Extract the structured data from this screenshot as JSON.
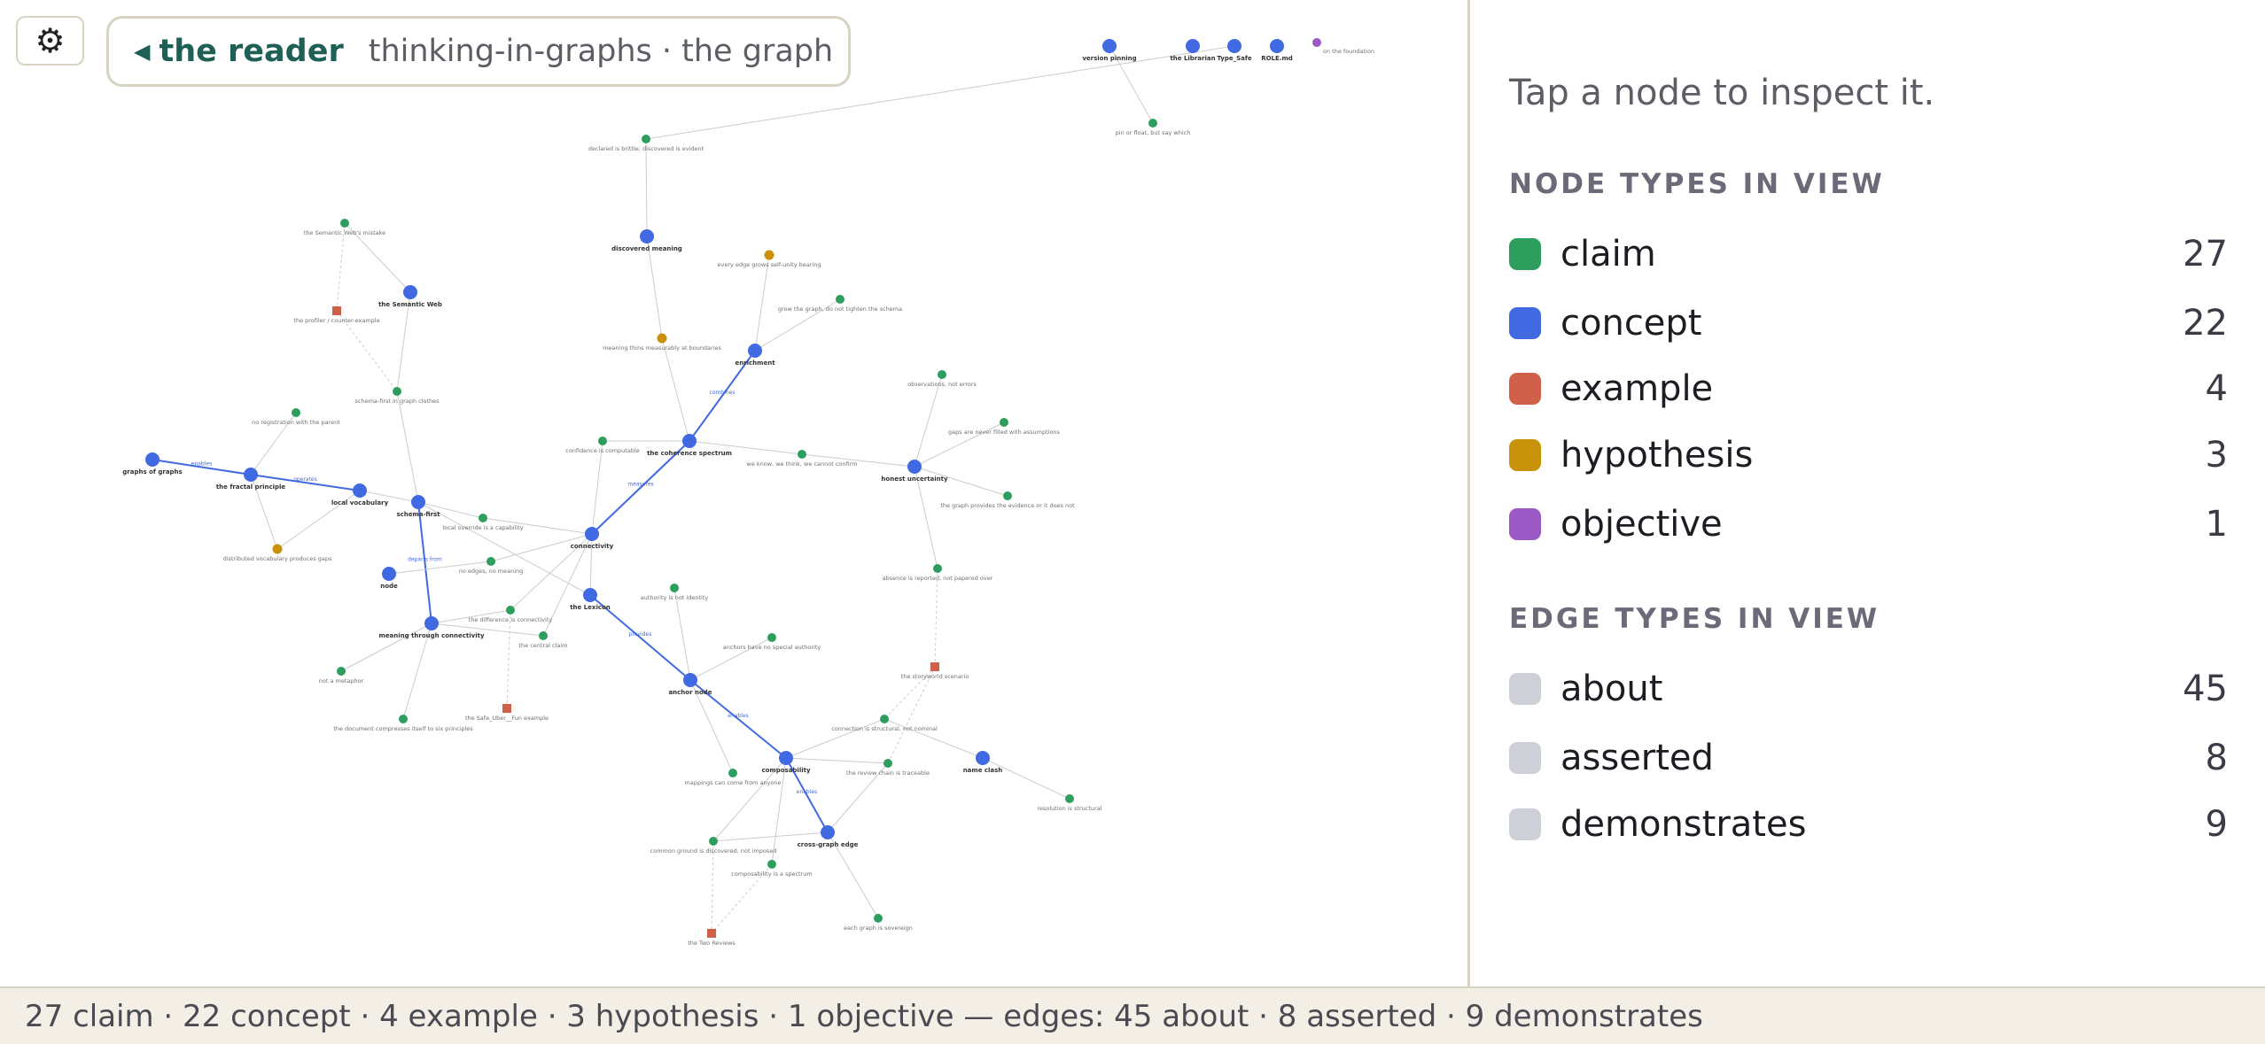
{
  "toolbar": {
    "settings_icon": "gear-icon",
    "settings_glyph": "⚙"
  },
  "breadcrumb": {
    "back_icon": "caret-left-icon",
    "back_label": "the reader",
    "path": "thinking-in-graphs · the graph"
  },
  "inspector": {
    "hint": "Tap a node to inspect it.",
    "node_types_title": "NODE TYPES IN VIEW",
    "node_types": [
      {
        "key": "claim",
        "label": "claim",
        "count": "27",
        "color": "#2e9e5f"
      },
      {
        "key": "concept",
        "label": "concept",
        "count": "22",
        "color": "#4169e1"
      },
      {
        "key": "example",
        "label": "example",
        "count": "4",
        "color": "#d0604a"
      },
      {
        "key": "hypothesis",
        "label": "hypothesis",
        "count": "3",
        "color": "#c8930a"
      },
      {
        "key": "objective",
        "label": "objective",
        "count": "1",
        "color": "#9b59c6"
      }
    ],
    "edge_types_title": "EDGE TYPES IN VIEW",
    "edge_types": [
      {
        "key": "about",
        "label": "about",
        "count": "45",
        "color": "#cdd0d6"
      },
      {
        "key": "asserted",
        "label": "asserted",
        "count": "8",
        "color": "#cdd0d6"
      },
      {
        "key": "demonstrates",
        "label": "demonstrates",
        "count": "9",
        "color": "#cdd0d6"
      }
    ]
  },
  "status": "27 claim · 22 concept · 4 example · 3 hypothesis · 1 objective — edges: 45 about · 8 asserted · 9 demonstrates",
  "graph": {
    "edge_color": "#cccccc",
    "highlight_edge_color": "#4169e1",
    "nodes": [
      {
        "id": "version_pinning",
        "label": "version pinning",
        "type": "concept"
      },
      {
        "id": "the_librarian",
        "label": "the Librarian",
        "type": "concept"
      },
      {
        "id": "type_safe",
        "label": "Type_Safe",
        "type": "concept"
      },
      {
        "id": "role_md",
        "label": "ROLE.md",
        "type": "concept"
      },
      {
        "id": "the_foundation",
        "label": "on the foundation",
        "type": "objective"
      },
      {
        "id": "pin_or_float",
        "label": "pin or float, but say which",
        "type": "claim"
      },
      {
        "id": "declared_is_brittle",
        "label": "declared is brittle; discovered is evident",
        "type": "claim"
      },
      {
        "id": "discovered_meaning",
        "label": "discovered meaning",
        "type": "concept"
      },
      {
        "id": "every_edge_grows",
        "label": "every edge grows self-unity bearing",
        "type": "hypothesis"
      },
      {
        "id": "grow_the_graph",
        "label": "grow the graph, do not tighten the schema",
        "type": "claim"
      },
      {
        "id": "meaning_thins",
        "label": "meaning thins measurably at boundaries",
        "type": "hypothesis"
      },
      {
        "id": "enrichment",
        "label": "enrichment",
        "type": "concept"
      },
      {
        "id": "sw_mistake",
        "label": "the Semantic Web's mistake",
        "type": "claim"
      },
      {
        "id": "semantic_web",
        "label": "the Semantic Web",
        "type": "concept"
      },
      {
        "id": "the_profiler",
        "label": "the profiler / counter-example",
        "type": "example"
      },
      {
        "id": "schema_first_gr",
        "label": "schema-first in graph clothes",
        "type": "claim"
      },
      {
        "id": "no_registration",
        "label": "no registration with the parent",
        "type": "claim"
      },
      {
        "id": "observations",
        "label": "observations, not errors",
        "type": "claim"
      },
      {
        "id": "gaps_are_never",
        "label": "gaps are never filled with assumptions",
        "type": "claim"
      },
      {
        "id": "confidence_comp",
        "label": "confidence is computable",
        "type": "claim"
      },
      {
        "id": "coherence_spectrum",
        "label": "the coherence spectrum",
        "type": "concept"
      },
      {
        "id": "we_know_we_think",
        "label": "we know, we think, we cannot confirm",
        "type": "claim"
      },
      {
        "id": "honest_uncertainty",
        "label": "honest uncertainty",
        "type": "concept"
      },
      {
        "id": "graph_provides",
        "label": "the graph provides the evidence or it does not",
        "type": "claim"
      },
      {
        "id": "graphs_of_graphs",
        "label": "graphs of graphs",
        "type": "concept"
      },
      {
        "id": "fractal_principle",
        "label": "the fractal principle",
        "type": "concept"
      },
      {
        "id": "local_vocabulary",
        "label": "local vocabulary",
        "type": "concept"
      },
      {
        "id": "schema_first",
        "label": "schema-first",
        "type": "concept"
      },
      {
        "id": "local_override",
        "label": "local override is a capability",
        "type": "claim"
      },
      {
        "id": "connectivity",
        "label": "connectivity",
        "type": "concept"
      },
      {
        "id": "distributed_vocab",
        "label": "distributed vocabulary produces gaps",
        "type": "hypothesis"
      },
      {
        "id": "node",
        "label": "node",
        "type": "concept"
      },
      {
        "id": "no_edges",
        "label": "no edges, no meaning",
        "type": "claim"
      },
      {
        "id": "absence_is_reported",
        "label": "absence is reported, not papered over",
        "type": "claim"
      },
      {
        "id": "authority_is_not",
        "label": "authority is not identity",
        "type": "claim"
      },
      {
        "id": "the_lexicon",
        "label": "the Lexicon",
        "type": "concept"
      },
      {
        "id": "the_difference",
        "label": "the difference is connectivity",
        "type": "claim"
      },
      {
        "id": "meaning_through",
        "label": "meaning through connectivity",
        "type": "concept"
      },
      {
        "id": "the_central_claim",
        "label": "the central claim",
        "type": "claim"
      },
      {
        "id": "anchors_have_no",
        "label": "anchors have no special authority",
        "type": "claim"
      },
      {
        "id": "not_a_metaphor",
        "label": "not a metaphor",
        "type": "claim"
      },
      {
        "id": "the_storyworld",
        "label": "the storyworld scenario",
        "type": "example"
      },
      {
        "id": "the_safe_uber",
        "label": "the Safe_Uber__Fun example",
        "type": "example"
      },
      {
        "id": "anchor_node",
        "label": "anchor node",
        "type": "concept"
      },
      {
        "id": "doc_compresses",
        "label": "the document compresses itself to six principles",
        "type": "claim"
      },
      {
        "id": "connection_is_structural",
        "label": "connection is structural, not nominal",
        "type": "claim"
      },
      {
        "id": "name_clash",
        "label": "name clash",
        "type": "concept"
      },
      {
        "id": "composability",
        "label": "composability",
        "type": "concept"
      },
      {
        "id": "review_chain",
        "label": "the review chain is traceable",
        "type": "claim"
      },
      {
        "id": "mappings_can_come",
        "label": "mappings can come from anyone",
        "type": "claim"
      },
      {
        "id": "resolution_structural",
        "label": "resolution is structural",
        "type": "claim"
      },
      {
        "id": "cross_graph_edge",
        "label": "cross-graph edge",
        "type": "concept"
      },
      {
        "id": "common_ground",
        "label": "common ground is discovered, not imposed",
        "type": "claim"
      },
      {
        "id": "composability_spectrum",
        "label": "composability is a spectrum",
        "type": "claim"
      },
      {
        "id": "each_graph_sovereign",
        "label": "each graph is sovereign",
        "type": "claim"
      },
      {
        "id": "the_two_reviews",
        "label": "the Two Reviews",
        "type": "example"
      }
    ],
    "edges": [
      {
        "from": "version_pinning",
        "to": "pin_or_float",
        "type": "about"
      },
      {
        "from": "declared_is_brittle",
        "to": "discovered_meaning",
        "type": "about"
      },
      {
        "from": "discovered_meaning",
        "to": "meaning_thins",
        "type": "about"
      },
      {
        "from": "meaning_thins",
        "to": "coherence_spectrum",
        "type": "about"
      },
      {
        "from": "every_edge_grows",
        "to": "enrichment",
        "type": "about"
      },
      {
        "from": "grow_the_graph",
        "to": "enrichment",
        "type": "about"
      },
      {
        "from": "enrichment",
        "to": "coherence_spectrum",
        "type": "asserted",
        "label": "combines"
      },
      {
        "from": "sw_mistake",
        "to": "semantic_web",
        "type": "about"
      },
      {
        "from": "sw_mistake",
        "to": "the_profiler",
        "type": "demonstrates"
      },
      {
        "from": "the_profiler",
        "to": "schema_first_gr",
        "type": "demonstrates"
      },
      {
        "from": "semantic_web",
        "to": "schema_first_gr",
        "type": "about"
      },
      {
        "from": "schema_first_gr",
        "to": "schema_first",
        "type": "about"
      },
      {
        "from": "no_registration",
        "to": "fractal_principle",
        "type": "about"
      },
      {
        "from": "graphs_of_graphs",
        "to": "fractal_principle",
        "type": "asserted",
        "label": "enables"
      },
      {
        "from": "fractal_principle",
        "to": "local_vocabulary",
        "type": "asserted",
        "label": "operates"
      },
      {
        "from": "fractal_principle",
        "to": "distributed_vocab",
        "type": "about"
      },
      {
        "from": "distributed_vocab",
        "to": "local_vocabulary",
        "type": "about"
      },
      {
        "from": "local_vocabulary",
        "to": "schema_first",
        "type": "about"
      },
      {
        "from": "schema_first",
        "to": "local_override",
        "type": "about"
      },
      {
        "from": "schema_first",
        "to": "meaning_through",
        "type": "asserted",
        "label": "departs from"
      },
      {
        "from": "confidence_comp",
        "to": "connectivity",
        "type": "about"
      },
      {
        "from": "confidence_comp",
        "to": "coherence_spectrum",
        "type": "about"
      },
      {
        "from": "coherence_spectrum",
        "to": "connectivity",
        "type": "asserted",
        "label": "measures"
      },
      {
        "from": "coherence_spectrum",
        "to": "we_know_we_think",
        "type": "about"
      },
      {
        "from": "we_know_we_think",
        "to": "honest_uncertainty",
        "type": "about"
      },
      {
        "from": "observations",
        "to": "honest_uncertainty",
        "type": "about"
      },
      {
        "from": "gaps_are_never",
        "to": "honest_uncertainty",
        "type": "about"
      },
      {
        "from": "honest_uncertainty",
        "to": "graph_provides",
        "type": "about"
      },
      {
        "from": "honest_uncertainty",
        "to": "absence_is_reported",
        "type": "about"
      },
      {
        "from": "absence_is_reported",
        "to": "the_storyworld",
        "type": "demonstrates"
      },
      {
        "from": "local_override",
        "to": "connectivity",
        "type": "about"
      },
      {
        "from": "no_edges",
        "to": "connectivity",
        "type": "about"
      },
      {
        "from": "no_edges",
        "to": "node",
        "type": "about"
      },
      {
        "from": "connectivity",
        "to": "the_difference",
        "type": "about"
      },
      {
        "from": "connectivity",
        "to": "the_central_claim",
        "type": "about"
      },
      {
        "from": "connectivity",
        "to": "the_lexicon",
        "type": "about"
      },
      {
        "from": "schema_first",
        "to": "the_lexicon",
        "type": "about"
      },
      {
        "from": "the_difference",
        "to": "meaning_through",
        "type": "about"
      },
      {
        "from": "the_central_claim",
        "to": "meaning_through",
        "type": "about"
      },
      {
        "from": "the_difference",
        "to": "the_safe_uber",
        "type": "demonstrates"
      },
      {
        "from": "meaning_through",
        "to": "not_a_metaphor",
        "type": "about"
      },
      {
        "from": "meaning_through",
        "to": "doc_compresses",
        "type": "about"
      },
      {
        "from": "authority_is_not",
        "to": "anchor_node",
        "type": "about"
      },
      {
        "from": "the_lexicon",
        "to": "anchor_node",
        "type": "asserted",
        "label": "provides"
      },
      {
        "from": "anchors_have_no",
        "to": "anchor_node",
        "type": "about"
      },
      {
        "from": "anchor_node",
        "to": "composability",
        "type": "asserted",
        "label": "enables"
      },
      {
        "from": "anchor_node",
        "to": "mappings_can_come",
        "type": "about"
      },
      {
        "from": "the_storyworld",
        "to": "connection_is_structural",
        "type": "demonstrates"
      },
      {
        "from": "connection_is_structural",
        "to": "composability",
        "type": "about"
      },
      {
        "from": "connection_is_structural",
        "to": "name_clash",
        "type": "about"
      },
      {
        "from": "name_clash",
        "to": "resolution_structural",
        "type": "about"
      },
      {
        "from": "review_chain",
        "to": "composability",
        "type": "about"
      },
      {
        "from": "review_chain",
        "to": "the_storyworld",
        "type": "demonstrates"
      },
      {
        "from": "composability",
        "to": "cross_graph_edge",
        "type": "asserted",
        "label": "enables"
      },
      {
        "from": "composability",
        "to": "common_ground",
        "type": "about"
      },
      {
        "from": "composability",
        "to": "composability_spectrum",
        "type": "about"
      },
      {
        "from": "cross_graph_edge",
        "to": "each_graph_sovereign",
        "type": "about"
      },
      {
        "from": "cross_graph_edge",
        "to": "review_chain",
        "type": "about"
      },
      {
        "from": "common_ground",
        "to": "the_two_reviews",
        "type": "demonstrates"
      },
      {
        "from": "composability_spectrum",
        "to": "the_two_reviews",
        "type": "demonstrates"
      },
      {
        "from": "cross_graph_edge",
        "to": "common_ground",
        "type": "about"
      },
      {
        "from": "declared_is_brittle",
        "to": "type_safe",
        "type": "about"
      }
    ]
  }
}
